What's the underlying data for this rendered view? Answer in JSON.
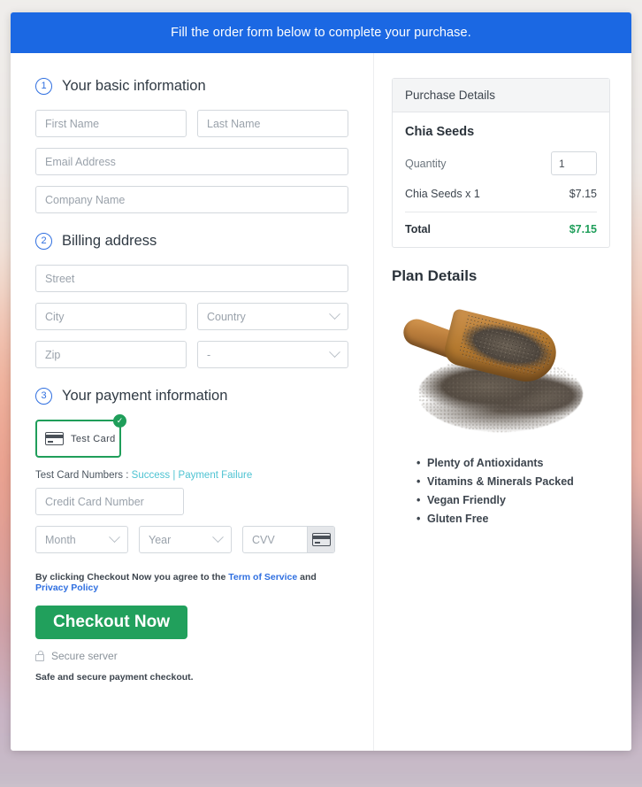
{
  "header": {
    "banner_text": "Fill the order form below to complete your purchase.",
    "banner_color": "#1b68e3"
  },
  "form": {
    "sections": [
      {
        "number": "1",
        "title": "Your basic information"
      },
      {
        "number": "2",
        "title": "Billing address"
      },
      {
        "number": "3",
        "title": "Your payment information"
      }
    ],
    "basic_information": {
      "first_name_placeholder": "First Name",
      "last_name_placeholder": "Last Name",
      "email_placeholder": "Email Address",
      "company_placeholder": "Company Name"
    },
    "billing_address": {
      "street_placeholder": "Street",
      "city_placeholder": "City",
      "country_placeholder": "Country",
      "zip_placeholder": "Zip",
      "state_placeholder": "-"
    },
    "payment": {
      "card_option_label": "Test  Card",
      "card_option_selected": true,
      "card_option_border_color": "#1f9e5a",
      "check_badge_glyph": "✓",
      "test_numbers_prefix": "Test Card Numbers :",
      "test_numbers_success": "Success",
      "test_numbers_separator": "|",
      "test_numbers_failure": "Payment Failure",
      "link_color": "#4ec3d2",
      "credit_card_placeholder": "Credit Card Number",
      "month_placeholder": "Month",
      "year_placeholder": "Year",
      "cvv_placeholder": "CVV"
    },
    "terms": {
      "text_before": "By clicking Checkout Now you agree to the ",
      "terms_link": "Term of Service",
      "text_middle": " and ",
      "privacy_link": "Privacy Policy",
      "link_color": "#2f6fe0"
    },
    "checkout_button_label": "Checkout Now",
    "checkout_button_color": "#21a05c",
    "secure_server_label": "Secure server",
    "safe_secure_note": "Safe and secure payment checkout."
  },
  "purchase_details": {
    "panel_title": "Purchase Details",
    "product_name": "Chia Seeds",
    "quantity_label": "Quantity",
    "quantity_value": "1",
    "line_item_label": "Chia Seeds x 1",
    "line_item_price": "$7.15",
    "total_label": "Total",
    "total_amount": "$7.15",
    "total_color": "#1f9e5a"
  },
  "plan_details": {
    "title": "Plan Details",
    "image_alt": "chia-seeds-wooden-scoop",
    "features": [
      "Plenty of Antioxidants",
      "Vitamins & Minerals Packed",
      "Vegan Friendly",
      "Gluten Free"
    ]
  }
}
